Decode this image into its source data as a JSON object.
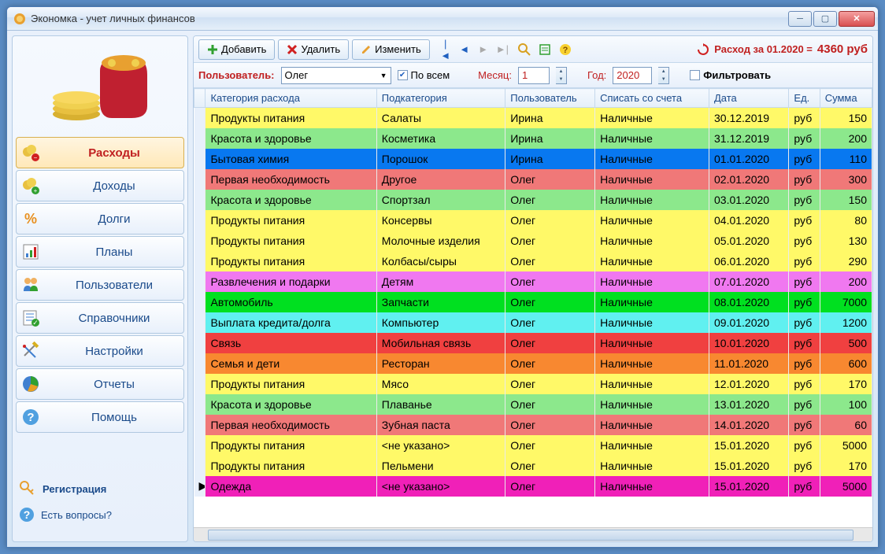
{
  "window": {
    "title": "Экономка - учет личных финансов"
  },
  "sidebar": {
    "items": [
      {
        "label": "Расходы"
      },
      {
        "label": "Доходы"
      },
      {
        "label": "Долги"
      },
      {
        "label": "Планы"
      },
      {
        "label": "Пользователи"
      },
      {
        "label": "Справочники"
      },
      {
        "label": "Настройки"
      },
      {
        "label": "Отчеты"
      },
      {
        "label": "Помощь"
      }
    ],
    "registration": "Регистрация",
    "questions": "Есть вопросы?"
  },
  "toolbar": {
    "add": "Добавить",
    "delete": "Удалить",
    "edit": "Изменить",
    "summary_prefix": "Расход за 01.2020 = ",
    "summary_value": "4360 руб"
  },
  "filter": {
    "user_label": "Пользователь:",
    "user_value": "Олег",
    "all_label": "По всем",
    "month_label": "Месяц:",
    "month_value": "1",
    "year_label": "Год:",
    "year_value": "2020",
    "filter_label": "Фильтровать"
  },
  "columns": {
    "category": "Категория расхода",
    "subcategory": "Подкатегория",
    "user": "Пользователь",
    "account": "Списать со счета",
    "date": "Дата",
    "unit": "Ед.",
    "sum": "Сумма"
  },
  "rows": [
    {
      "category": "Продукты питания",
      "sub": "Салаты",
      "user": "Ирина",
      "acc": "Наличные",
      "date": "30.12.2019",
      "unit": "руб",
      "sum": "150",
      "color": "yellow"
    },
    {
      "category": "Красота и здоровье",
      "sub": "Косметика",
      "user": "Ирина",
      "acc": "Наличные",
      "date": "31.12.2019",
      "unit": "руб",
      "sum": "200",
      "color": "lightgreen"
    },
    {
      "category": "Бытовая химия",
      "sub": "Порошок",
      "user": "Ирина",
      "acc": "Наличные",
      "date": "01.01.2020",
      "unit": "руб",
      "sum": "110",
      "color": "blue"
    },
    {
      "category": "Первая необходимость",
      "sub": "Другое",
      "user": "Олег",
      "acc": "Наличные",
      "date": "02.01.2020",
      "unit": "руб",
      "sum": "300",
      "color": "salmon"
    },
    {
      "category": "Красота и здоровье",
      "sub": "Спортзал",
      "user": "Олег",
      "acc": "Наличные",
      "date": "03.01.2020",
      "unit": "руб",
      "sum": "150",
      "color": "lightgreen"
    },
    {
      "category": "Продукты питания",
      "sub": "Консервы",
      "user": "Олег",
      "acc": "Наличные",
      "date": "04.01.2020",
      "unit": "руб",
      "sum": "80",
      "color": "yellow"
    },
    {
      "category": "Продукты питания",
      "sub": "Молочные изделия",
      "user": "Олег",
      "acc": "Наличные",
      "date": "05.01.2020",
      "unit": "руб",
      "sum": "130",
      "color": "yellow"
    },
    {
      "category": "Продукты питания",
      "sub": "Колбасы/сыры",
      "user": "Олег",
      "acc": "Наличные",
      "date": "06.01.2020",
      "unit": "руб",
      "sum": "290",
      "color": "yellow"
    },
    {
      "category": "Развлечения и подарки",
      "sub": "Детям",
      "user": "Олег",
      "acc": "Наличные",
      "date": "07.01.2020",
      "unit": "руб",
      "sum": "200",
      "color": "violet"
    },
    {
      "category": "Автомобиль",
      "sub": "Запчасти",
      "user": "Олег",
      "acc": "Наличные",
      "date": "08.01.2020",
      "unit": "руб",
      "sum": "7000",
      "color": "green"
    },
    {
      "category": "Выплата кредита/долга",
      "sub": "Компьютер",
      "user": "Олег",
      "acc": "Наличные",
      "date": "09.01.2020",
      "unit": "руб",
      "sum": "1200",
      "color": "cyan"
    },
    {
      "category": "Связь",
      "sub": "Мобильная связь",
      "user": "Олег",
      "acc": "Наличные",
      "date": "10.01.2020",
      "unit": "руб",
      "sum": "500",
      "color": "red"
    },
    {
      "category": "Семья и дети",
      "sub": "Ресторан",
      "user": "Олег",
      "acc": "Наличные",
      "date": "11.01.2020",
      "unit": "руб",
      "sum": "600",
      "color": "orange"
    },
    {
      "category": "Продукты питания",
      "sub": "Мясо",
      "user": "Олег",
      "acc": "Наличные",
      "date": "12.01.2020",
      "unit": "руб",
      "sum": "170",
      "color": "yellow"
    },
    {
      "category": "Красота и здоровье",
      "sub": "Плаванье",
      "user": "Олег",
      "acc": "Наличные",
      "date": "13.01.2020",
      "unit": "руб",
      "sum": "100",
      "color": "lightgreen"
    },
    {
      "category": "Первая необходимость",
      "sub": "Зубная паста",
      "user": "Олег",
      "acc": "Наличные",
      "date": "14.01.2020",
      "unit": "руб",
      "sum": "60",
      "color": "salmon"
    },
    {
      "category": "Продукты питания",
      "sub": "<не указано>",
      "user": "Олег",
      "acc": "Наличные",
      "date": "15.01.2020",
      "unit": "руб",
      "sum": "5000",
      "color": "yellow"
    },
    {
      "category": "Продукты питания",
      "sub": "Пельмени",
      "user": "Олег",
      "acc": "Наличные",
      "date": "15.01.2020",
      "unit": "руб",
      "sum": "170",
      "color": "yellow"
    },
    {
      "category": "Одежда",
      "sub": "<не указано>",
      "user": "Олег",
      "acc": "Наличные",
      "date": "15.01.2020",
      "unit": "руб",
      "sum": "5000",
      "color": "magenta"
    }
  ]
}
